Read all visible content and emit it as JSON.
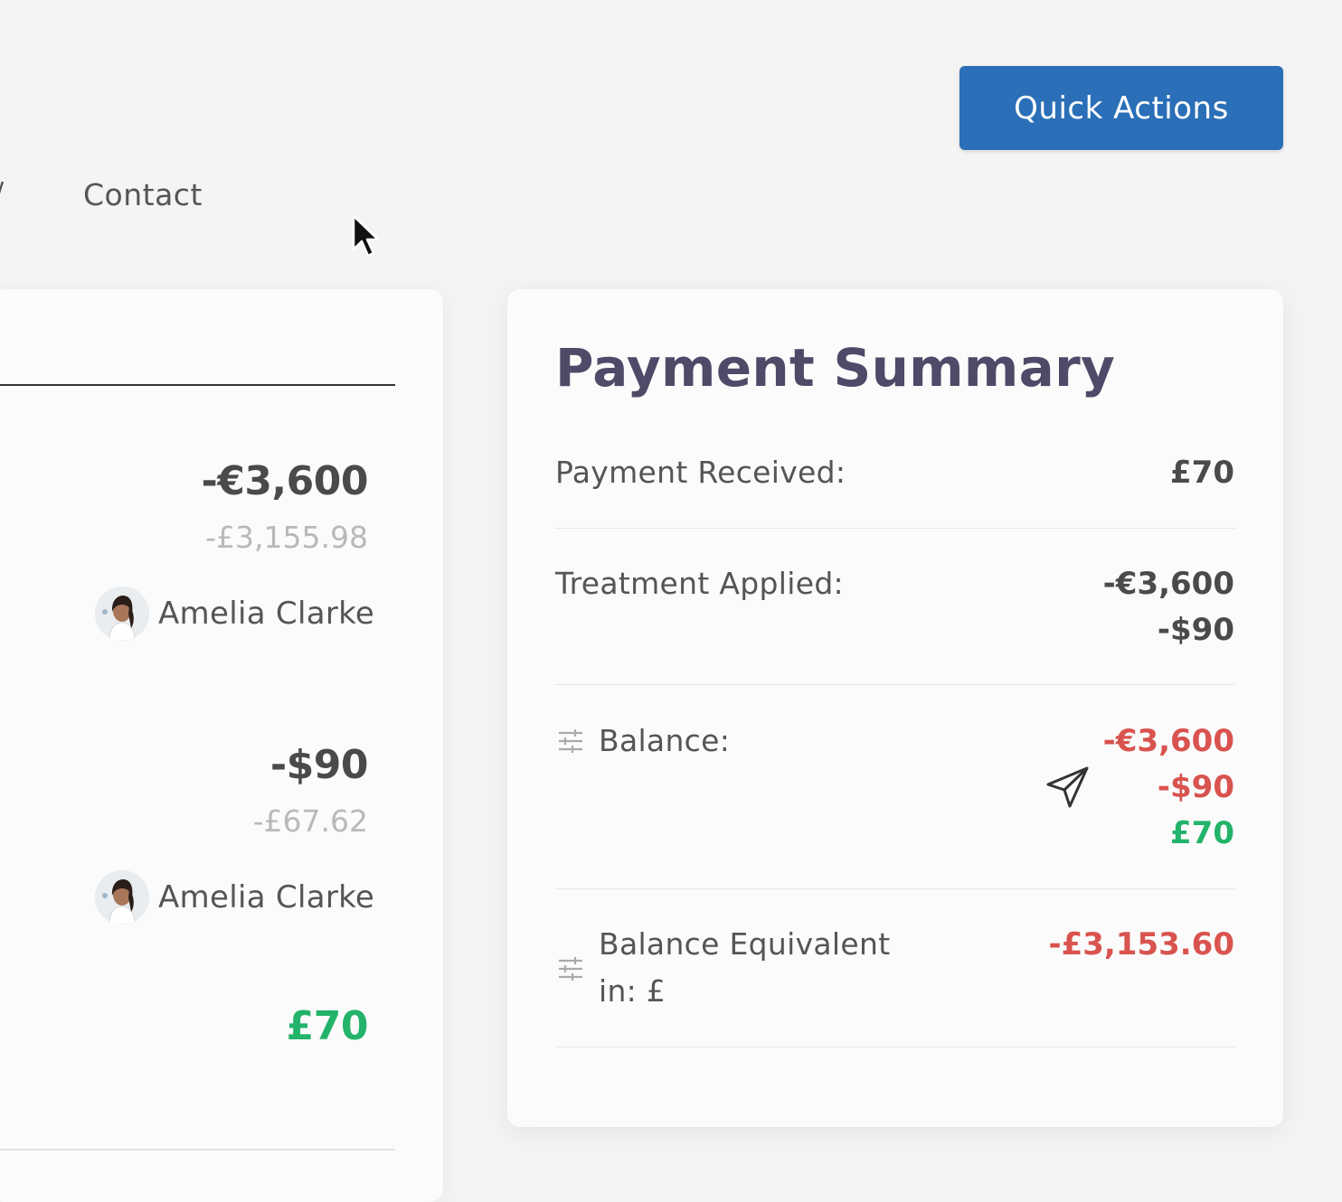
{
  "header": {
    "nav_edge": "/",
    "nav_contact": "Contact",
    "quick_actions_label": "Quick Actions"
  },
  "left_panel": {
    "entries": [
      {
        "amount": "-€3,600",
        "converted": "-£3,155.98",
        "person": "Amelia Clarke"
      },
      {
        "amount": "-$90",
        "converted": "-£67.62",
        "person": "Amelia Clarke"
      },
      {
        "amount": "£70"
      }
    ]
  },
  "payment_summary": {
    "title": "Payment Summary",
    "payment_received_label": "Payment Received:",
    "payment_received_value": "£70",
    "treatment_applied_label": "Treatment Applied:",
    "treatment_applied_values": [
      "-€3,600",
      "-$90"
    ],
    "balance_label": "Balance:",
    "balance_values": [
      "-€3,600",
      "-$90",
      "£70"
    ],
    "balance_equivalent_label_line1": "Balance Equivalent",
    "balance_equivalent_label_line2": "in: £",
    "balance_equivalent_value": "-£3,153.60"
  },
  "colors": {
    "accent_blue": "#2a6fb7",
    "title_purple": "#4f4a68",
    "negative_red": "#d9534f",
    "positive_green": "#23b36a"
  },
  "icons": [
    "cursor-icon",
    "avatar-icon",
    "sliders-icon",
    "send-icon"
  ]
}
